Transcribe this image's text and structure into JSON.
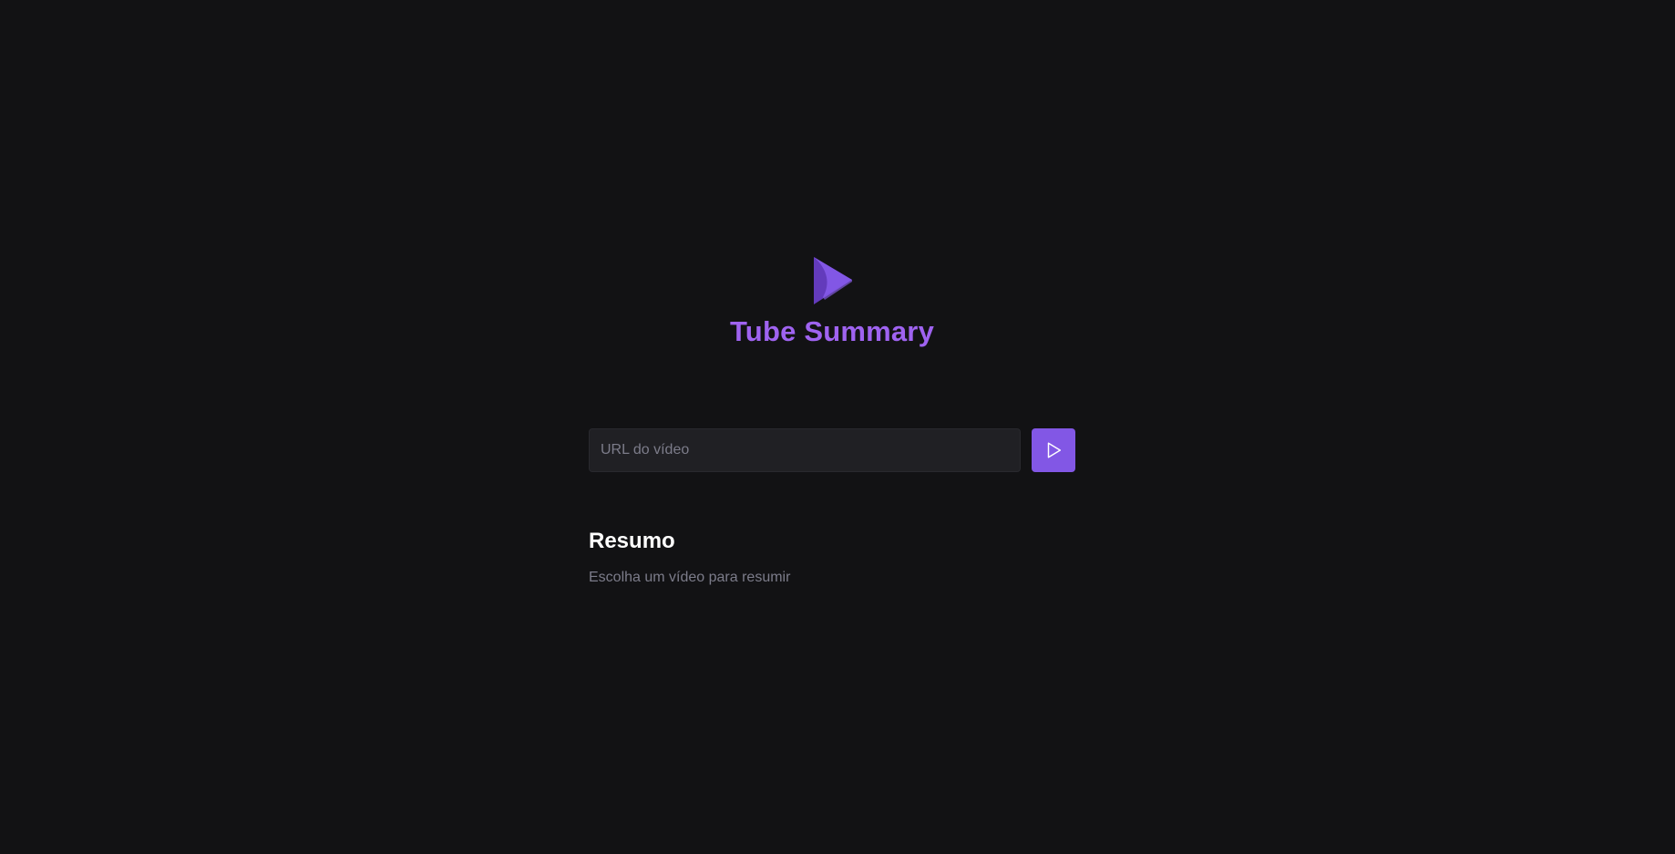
{
  "app": {
    "title": "Tube Summary",
    "logo_icon": "play-triangle-logo-icon"
  },
  "form": {
    "url_placeholder": "URL do vídeo",
    "url_value": "",
    "submit_icon": "play-icon"
  },
  "summary": {
    "title": "Resumo",
    "text": "Escolha um vídeo para resumir"
  },
  "colors": {
    "background": "#121214",
    "accent": "#8257e5",
    "title": "#9f63f0",
    "input_background": "#202024",
    "muted_text": "#7c7c8a",
    "heading_text": "#ffffff"
  }
}
